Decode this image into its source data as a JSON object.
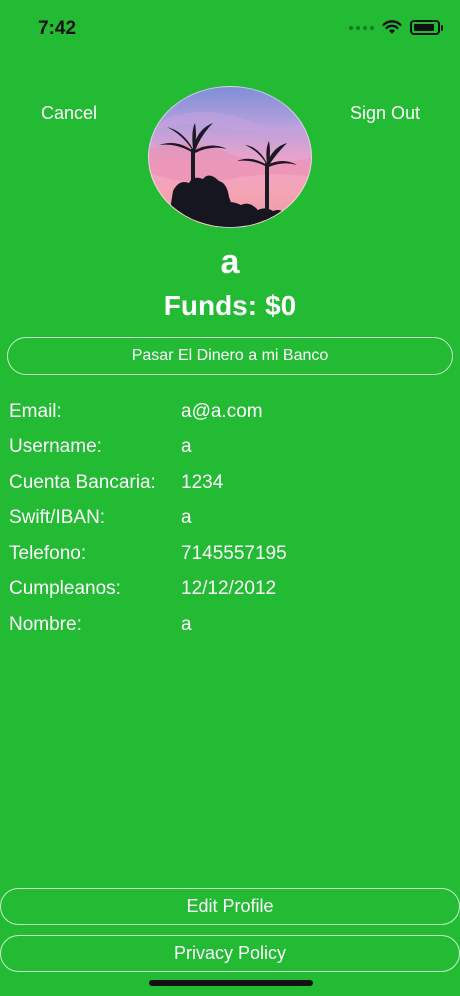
{
  "status": {
    "time": "7:42"
  },
  "header": {
    "cancel_label": "Cancel",
    "sign_out_label": "Sign Out"
  },
  "profile": {
    "name": "a",
    "funds_label": "Funds:",
    "funds_value": "$0",
    "transfer_label": "Pasar El Dinero a mi Banco"
  },
  "info": {
    "email_label": "Email:",
    "email_value": "a@a.com",
    "username_label": "Username:",
    "username_value": "a",
    "bank_label": "Cuenta Bancaria:",
    "bank_value": "1234",
    "swift_label": "Swift/IBAN:",
    "swift_value": "a",
    "phone_label": "Telefono:",
    "phone_value": "7145557195",
    "birthday_label": "Cumpleanos:",
    "birthday_value": "12/12/2012",
    "name_label": "Nombre:",
    "name_value": "a"
  },
  "footer": {
    "edit_label": "Edit Profile",
    "privacy_label": "Privacy Policy"
  },
  "colors": {
    "background": "#22bb33",
    "text": "#ffffff"
  },
  "icons": [
    "wifi-icon",
    "battery-icon",
    "cellular-signal-icon"
  ]
}
